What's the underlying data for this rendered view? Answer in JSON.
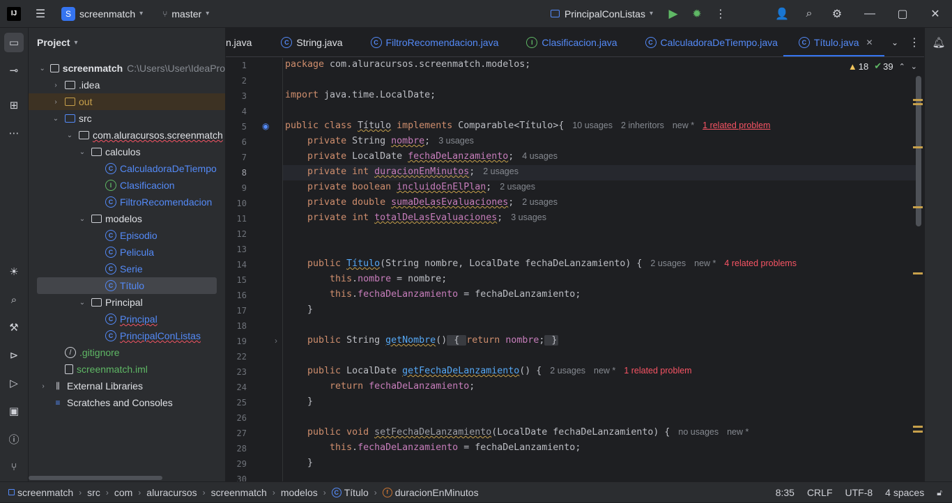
{
  "titlebar": {
    "logo": "IJ",
    "project_badge": "S",
    "project_name": "screenmatch",
    "branch": "master",
    "run_config": "PrincipalConListas"
  },
  "project_panel": {
    "title": "Project",
    "tree": [
      {
        "label": "screenmatch",
        "path": "C:\\Users\\User\\IdeaPro",
        "kind": "module",
        "depth": 0
      },
      {
        "label": ".idea",
        "kind": "folder",
        "depth": 1
      },
      {
        "label": "out",
        "kind": "folder-excluded",
        "depth": 1
      },
      {
        "label": "src",
        "kind": "folder",
        "depth": 1
      },
      {
        "label": "com.aluracursos.screenmatch",
        "kind": "package",
        "depth": 2
      },
      {
        "label": "calculos",
        "kind": "package",
        "depth": 3
      },
      {
        "label": "CalculadoraDeTiempo",
        "kind": "class",
        "depth": 4
      },
      {
        "label": "Clasificacion",
        "kind": "interface",
        "depth": 4
      },
      {
        "label": "FiltroRecomendacion",
        "kind": "class",
        "depth": 4
      },
      {
        "label": "modelos",
        "kind": "package",
        "depth": 3
      },
      {
        "label": "Episodio",
        "kind": "class",
        "depth": 4
      },
      {
        "label": "Pelicula",
        "kind": "class",
        "depth": 4
      },
      {
        "label": "Serie",
        "kind": "class",
        "depth": 4
      },
      {
        "label": "Título",
        "kind": "class",
        "depth": 4
      },
      {
        "label": "Principal",
        "kind": "package",
        "depth": 3
      },
      {
        "label": "Principal",
        "kind": "class-main",
        "depth": 4
      },
      {
        "label": "PrincipalConListas",
        "kind": "class-main",
        "depth": 4
      },
      {
        "label": ".gitignore",
        "kind": "ignore",
        "depth": 1
      },
      {
        "label": "screenmatch.iml",
        "kind": "file",
        "depth": 1
      },
      {
        "label": "External Libraries",
        "kind": "libs",
        "depth": 0
      },
      {
        "label": "Scratches and Consoles",
        "kind": "scratch",
        "depth": 0
      }
    ]
  },
  "tabs": [
    {
      "label": "n.java",
      "icon": "java-file-icon"
    },
    {
      "label": "String.java",
      "icon": "class-icon"
    },
    {
      "label": "FiltroRecomendacion.java",
      "icon": "class-icon"
    },
    {
      "label": "Clasificacion.java",
      "icon": "interface-icon"
    },
    {
      "label": "CalculadoraDeTiempo.java",
      "icon": "class-icon"
    },
    {
      "label": "Título.java",
      "icon": "class-icon",
      "active": true
    }
  ],
  "inspections": {
    "warnings": "18",
    "weak_warnings": "39"
  },
  "editor": {
    "line_numbers": [
      "1",
      "2",
      "3",
      "4",
      "5",
      "6",
      "7",
      "8",
      "9",
      "10",
      "11",
      "12",
      "13",
      "14",
      "15",
      "16",
      "17",
      "18",
      "19",
      "22",
      "23",
      "24",
      "25",
      "26",
      "27",
      "28",
      "29",
      "30"
    ],
    "current_line": "8",
    "code": {
      "l1_kw": "package",
      "l1_rest": " com.aluracursos.screenmatch.modelos;",
      "l3_kw": "import",
      "l3_rest": " java.time.LocalDate;",
      "l5_kw1": "public class",
      "l5_name": "Título",
      "l5_kw2": "implements",
      "l5_rest": " Comparable<Título>{",
      "l5_h1": "10 usages",
      "l5_h2": "2 inheritors",
      "l5_h3": "new *",
      "l5_prob": "1 related problem",
      "l6_kw": "private",
      "l6_type": " String ",
      "l6_f": "nombre",
      "l6_end": ";",
      "l6_h": "3 usages",
      "l7_kw": "private",
      "l7_type": " LocalDate ",
      "l7_f": "fechaDeLanzamiento",
      "l7_end": ";",
      "l7_h": "4 usages",
      "l8_kw": "private int",
      "l8_f": "duracionEnMinutos",
      "l8_end": ";",
      "l8_h": "2 usages",
      "l9_kw": "private boolean",
      "l9_f": "incluidoEnElPlan",
      "l9_end": ";",
      "l9_h": "2 usages",
      "l10_kw": "private double",
      "l10_f": "sumaDeLasEvaluaciones",
      "l10_end": ";",
      "l10_h": "2 usages",
      "l11_kw": "private int",
      "l11_f": "totalDeLasEvaluaciones",
      "l11_end": ";",
      "l11_h": "3 usages",
      "l14_kw": "public",
      "l14_m": "Título",
      "l14_rest": "(String nombre, LocalDate fechaDeLanzamiento) {",
      "l14_h1": "2 usages",
      "l14_h2": "new *",
      "l14_prob": "4 related problems",
      "l15_kw": "this",
      "l15_f": "nombre",
      "l15_rest": " = nombre;",
      "l16_kw": "this",
      "l16_f": "fechaDeLanzamiento",
      "l16_rest": " = fechaDeLanzamiento;",
      "l17": "}",
      "l19_kw": "public",
      "l19_type": " String ",
      "l19_m": "getNombre",
      "l19_rest": "()",
      "l19_fold_open": "{",
      "l19_kw2": "return",
      "l19_f": "nombre",
      "l19_fold_close": "}",
      "l23_kw": "public",
      "l23_type": " LocalDate ",
      "l23_m": "getFechaDeLanzamiento",
      "l23_rest": "() {",
      "l23_h1": "2 usages",
      "l23_h2": "new *",
      "l23_prob": "1 related problem",
      "l24_kw": "return",
      "l24_f": "fechaDeLanzamiento",
      "l24_end": ";",
      "l25": "}",
      "l27_kw": "public void",
      "l27_m": "setFechaDeLanzamiento",
      "l27_rest": "(LocalDate fechaDeLanzamiento) {",
      "l27_h1": "no usages",
      "l27_h2": "new *",
      "l28_kw": "this",
      "l28_f": "fechaDeLanzamiento",
      "l28_rest": " = fechaDeLanzamiento;",
      "l29": "}"
    }
  },
  "statusbar": {
    "crumbs": [
      "screenmatch",
      "src",
      "com",
      "aluracursos",
      "screenmatch",
      "modelos",
      "Título",
      "duracionEnMinutos"
    ],
    "position": "8:35",
    "line_sep": "CRLF",
    "encoding": "UTF-8",
    "indent": "4 spaces"
  }
}
